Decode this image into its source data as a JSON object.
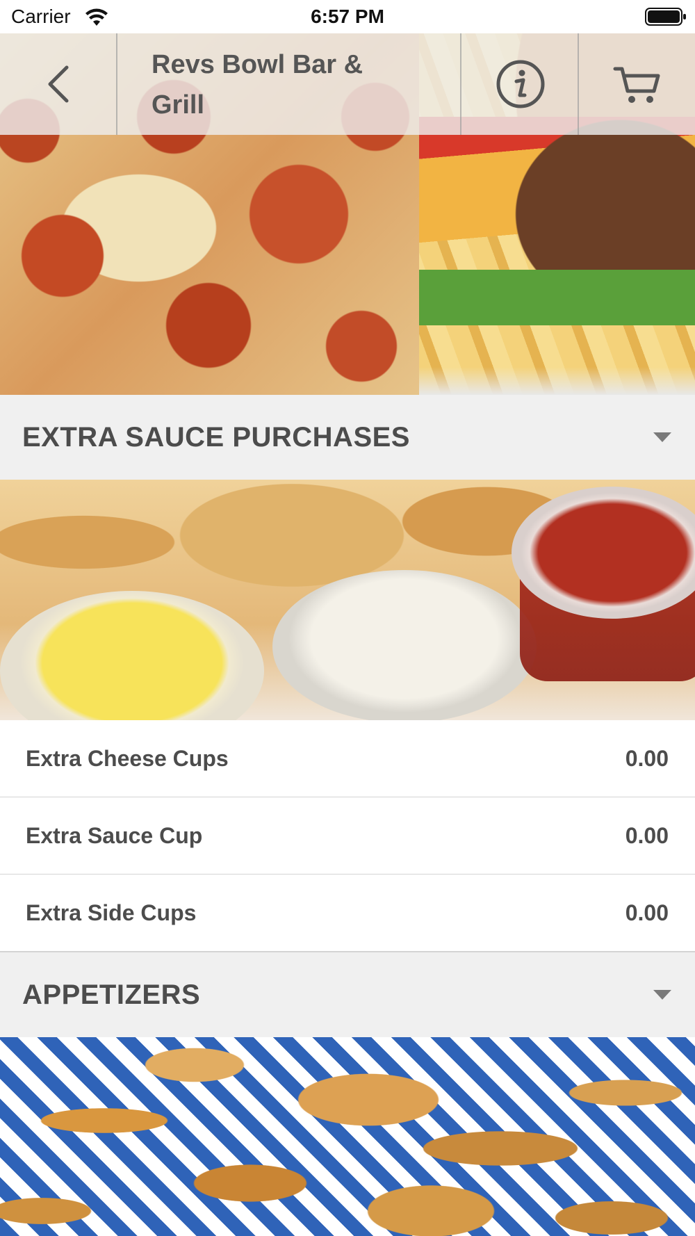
{
  "status_bar": {
    "carrier": "Carrier",
    "time": "6:57 PM",
    "icons": [
      "wifi-icon",
      "battery-icon"
    ]
  },
  "nav": {
    "title": "Revs Bowl Bar & Grill",
    "back_icon": "chevron-left-icon",
    "info_icon": "info-icon",
    "cart_icon": "cart-icon"
  },
  "sections": [
    {
      "title": "EXTRA SAUCE PURCHASES",
      "items": [
        {
          "name": "Extra Cheese Cups",
          "price": "0.00"
        },
        {
          "name": "Extra Sauce Cup",
          "price": "0.00"
        },
        {
          "name": "Extra Side Cups",
          "price": "0.00"
        }
      ]
    },
    {
      "title": "APPETIZERS",
      "items": []
    }
  ],
  "colors": {
    "section_header_bg": "#f0f0f0",
    "text": "#4c4c4c",
    "divider": "#d4d4d4"
  }
}
